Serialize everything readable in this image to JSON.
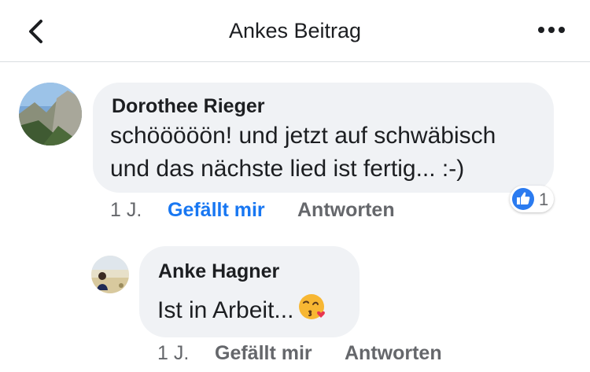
{
  "header": {
    "title": "Ankes Beitrag",
    "back_icon": "chevron-left-icon",
    "more_icon": "more-dots-icon"
  },
  "comments": [
    {
      "author": "Dorothee Rieger",
      "lines": [
        "schööööön! und jetzt auf schwäbisch",
        "und das nächste lied ist fertig... :-)"
      ],
      "time": "1 J.",
      "like_label": "Gefällt mir",
      "liked": true,
      "reply_label": "Antworten",
      "reaction_count": "1",
      "reaction_icon": "thumbs-up-icon"
    },
    {
      "author": "Anke Hagner",
      "text": "Ist in Arbeit...",
      "emoji": "kissing-face-heart-emoji",
      "time": "1 J.",
      "like_label": "Gefällt mir",
      "liked": false,
      "reply_label": "Antworten"
    }
  ],
  "colors": {
    "accent": "#1877f2",
    "bubble": "#f0f2f5",
    "meta": "#65676b"
  }
}
